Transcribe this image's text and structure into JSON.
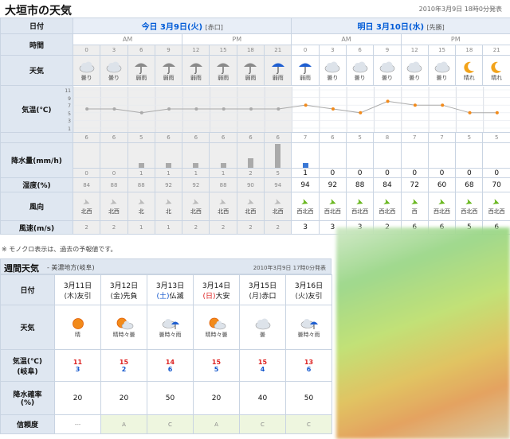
{
  "header": {
    "title": "大垣市の天気",
    "published": "2010年3月9日 18時0分発表"
  },
  "hourly": {
    "row_labels": {
      "date": "日付",
      "time": "時間",
      "weather": "天気",
      "temp": "気温(℃)",
      "precip": "降水量(mm/h)",
      "humidity": "湿度(%)",
      "wind_dir": "風向",
      "wind_speed": "風速(m/s)"
    },
    "today": {
      "date": "今日 3月9日(火)",
      "rokuyo": "[赤口]"
    },
    "tomorrow": {
      "date": "明日 3月10日(水)",
      "rokuyo": "[先勝]"
    },
    "ampm": [
      "AM",
      "PM",
      "AM",
      "PM"
    ],
    "hours": [
      "0",
      "3",
      "6",
      "9",
      "12",
      "15",
      "18",
      "21",
      "0",
      "3",
      "6",
      "9",
      "12",
      "15",
      "18",
      "21"
    ],
    "weather": [
      "曇り",
      "曇り",
      "弱雨",
      "弱雨",
      "弱雨",
      "弱雨",
      "弱雨",
      "弱雨",
      "弱雨",
      "曇り",
      "曇り",
      "曇り",
      "曇り",
      "曇り",
      "晴れ",
      "晴れ"
    ],
    "weather_icons": [
      "cloud-icon",
      "cloud-icon",
      "umbrella-icon",
      "umbrella-icon",
      "umbrella-icon",
      "umbrella-icon",
      "umbrella-icon",
      "umbrella-blue-icon",
      "umbrella-blue-icon",
      "cloud-icon",
      "cloud-icon",
      "cloud-icon",
      "cloud-icon",
      "cloud-icon",
      "moon-icon",
      "moon-icon"
    ],
    "temp_axis": [
      "11",
      "9",
      "7",
      "5",
      "3",
      "1"
    ],
    "temps": [
      "6",
      "6",
      "5",
      "6",
      "6",
      "6",
      "6",
      "6",
      "7",
      "6",
      "5",
      "8",
      "7",
      "7",
      "5",
      "5"
    ],
    "precip": [
      "0",
      "0",
      "1",
      "1",
      "1",
      "1",
      "2",
      "5",
      "1",
      "0",
      "0",
      "0",
      "0",
      "0",
      "0",
      "0"
    ],
    "humidity": [
      "84",
      "88",
      "88",
      "92",
      "92",
      "88",
      "90",
      "94",
      "94",
      "92",
      "88",
      "84",
      "72",
      "60",
      "68",
      "70"
    ],
    "wind_dir": [
      "北西",
      "北西",
      "北",
      "北",
      "北西",
      "北西",
      "北西",
      "北西",
      "西北西",
      "西北西",
      "西北西",
      "西北西",
      "西",
      "西北西",
      "西北西",
      "西北西"
    ],
    "wind_speed": [
      "2",
      "2",
      "1",
      "1",
      "2",
      "2",
      "2",
      "2",
      "3",
      "3",
      "3",
      "2",
      "6",
      "6",
      "5",
      "6"
    ],
    "note": "※ モノクロ表示は、過去の予報値です。"
  },
  "weekly": {
    "title": "週間天気",
    "subtitle": "- 美濃地方(岐阜)",
    "published": "2010年3月9日 17時0分発表",
    "row_labels": {
      "date": "日付",
      "weather": "天気",
      "temp": "気温(℃)",
      "temp_sub": "(岐阜)",
      "pop": "降水確率",
      "pop_sub": "(%)",
      "reliability": "信頼度"
    },
    "days": [
      {
        "date": "3月11日",
        "dow": "(木)",
        "rokuyo": "友引",
        "weather": "晴",
        "icon": "sun-icon",
        "high": "11",
        "low": "3",
        "pop": "20",
        "rel": "---"
      },
      {
        "date": "3月12日",
        "dow": "(金)",
        "rokuyo": "先負",
        "weather": "晴時々曇",
        "icon": "sun-cloud-icon",
        "high": "15",
        "low": "2",
        "pop": "20",
        "rel": "A"
      },
      {
        "date": "3月13日",
        "dow": "(土)",
        "rokuyo": "仏滅",
        "weather": "曇時々雨",
        "icon": "cloud-umbrella-icon",
        "high": "14",
        "low": "6",
        "pop": "50",
        "rel": "C"
      },
      {
        "date": "3月14日",
        "dow": "(日)",
        "rokuyo": "大安",
        "weather": "晴時々曇",
        "icon": "sun-cloud-icon",
        "high": "15",
        "low": "5",
        "pop": "20",
        "rel": "A"
      },
      {
        "date": "3月15日",
        "dow": "(月)",
        "rokuyo": "赤口",
        "weather": "曇",
        "icon": "cloud-icon",
        "high": "15",
        "low": "4",
        "pop": "40",
        "rel": "C"
      },
      {
        "date": "3月16日",
        "dow": "(火)",
        "rokuyo": "友引",
        "weather": "曇時々雨",
        "icon": "cloud-umbrella-icon",
        "high": "13",
        "low": "6",
        "pop": "50",
        "rel": "C"
      }
    ]
  }
}
